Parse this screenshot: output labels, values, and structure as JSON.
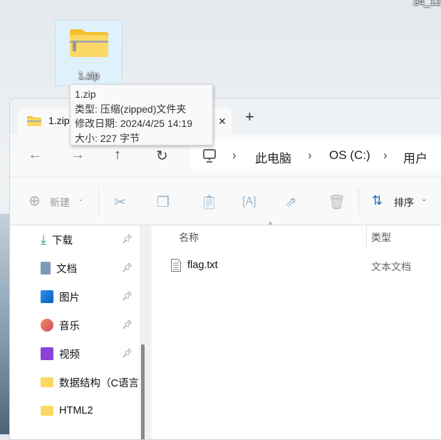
{
  "desktop": {
    "clock_fragment": "24_12",
    "icon_label": "1.zip"
  },
  "tooltip": {
    "name": "1.zip",
    "type": "类型: 压缩(zipped)文件夹",
    "modified": "修改日期: 2024/4/25 14:19",
    "size": "大小: 227 字节"
  },
  "window": {
    "tab_title": "1.zip",
    "close_glyph": "✕",
    "new_tab": "+",
    "breadcrumb": [
      "此电脑",
      "OS (C:)",
      "用户"
    ],
    "toolbar": {
      "new_label": "新建",
      "sort_label": "排序"
    },
    "sidebar": [
      {
        "label": "下载",
        "pinned": true
      },
      {
        "label": "文档",
        "pinned": true
      },
      {
        "label": "图片",
        "pinned": true
      },
      {
        "label": "音乐",
        "pinned": true
      },
      {
        "label": "视频",
        "pinned": true
      },
      {
        "label": "数据结构（C语言",
        "pinned": false
      },
      {
        "label": "HTML2",
        "pinned": false
      }
    ],
    "columns": {
      "name": "名称",
      "type": "类型"
    },
    "files": [
      {
        "name": "flag.txt",
        "type": "文本文档"
      }
    ]
  }
}
